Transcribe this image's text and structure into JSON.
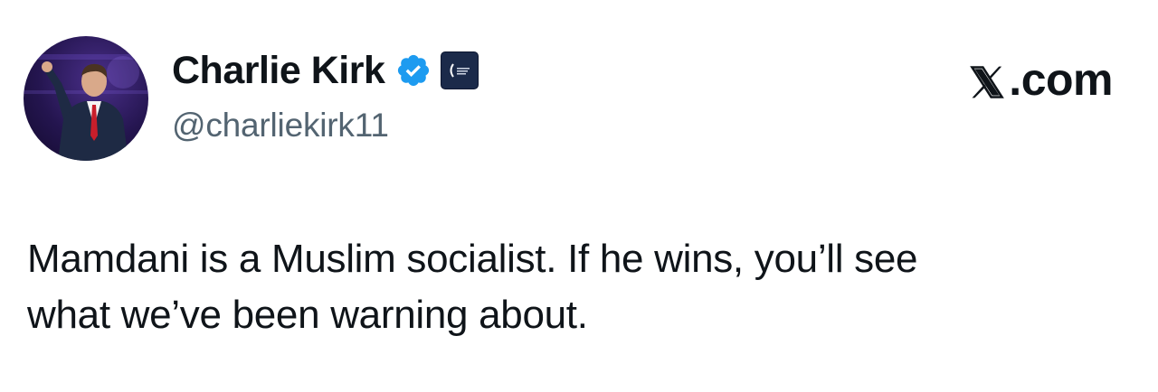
{
  "tweet": {
    "author": {
      "display_name": "Charlie Kirk",
      "handle": "@charliekirk11",
      "verified_icon": "verified-badge-icon",
      "affiliate_icon": "affiliate-organization-badge-icon"
    },
    "source": {
      "label": ".com",
      "logo": "x-logo-icon"
    },
    "text_lines": [
      "Mamdani is a Muslim socialist. If he wins, you’ll see",
      "what we’ve been warning about."
    ]
  },
  "colors": {
    "text_primary": "#0f1419",
    "text_secondary": "#536471",
    "verified_blue": "#1d9bf0",
    "background": "#ffffff"
  }
}
